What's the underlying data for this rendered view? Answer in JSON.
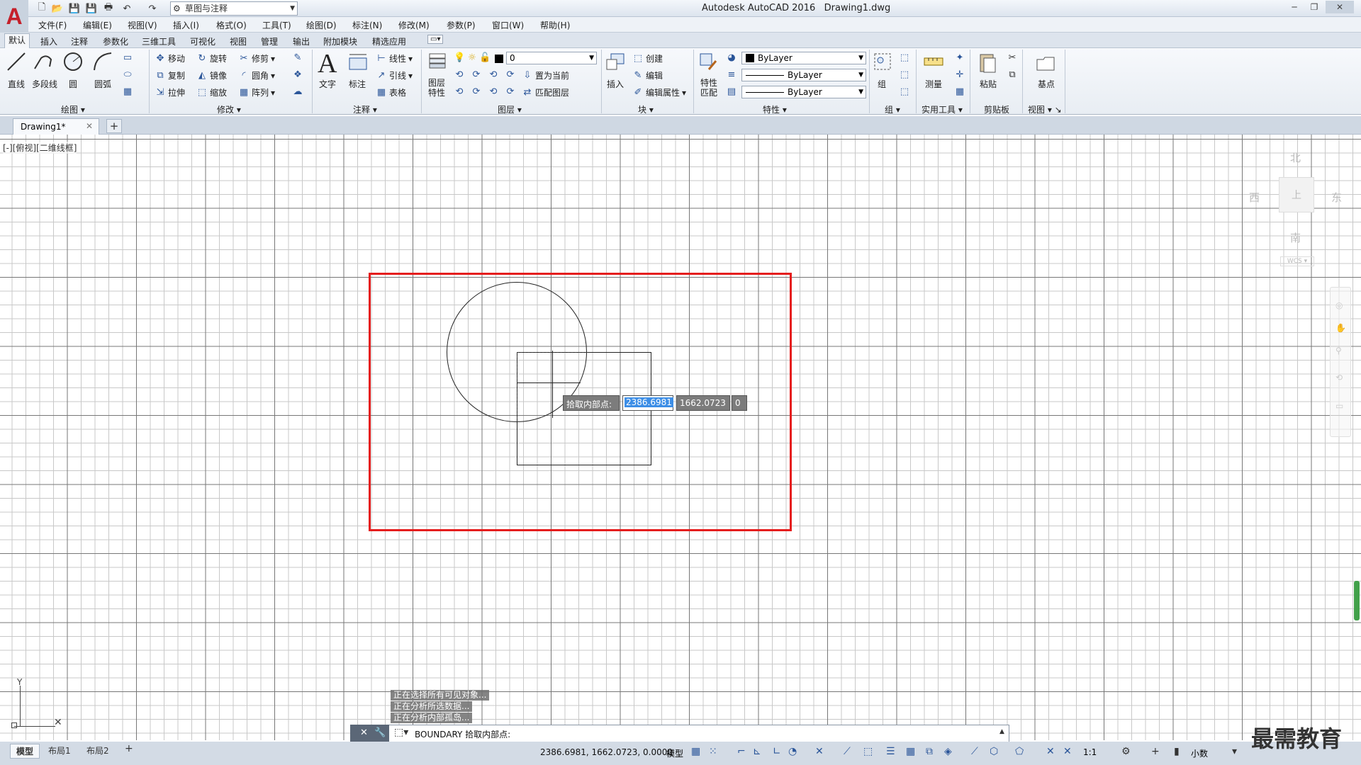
{
  "titlebar": {
    "app_title": "Autodesk AutoCAD 2016",
    "document": "Drawing1.dwg",
    "workspace": "草图与注释"
  },
  "menu": [
    "文件(F)",
    "编辑(E)",
    "视图(V)",
    "插入(I)",
    "格式(O)",
    "工具(T)",
    "绘图(D)",
    "标注(N)",
    "修改(M)",
    "参数(P)",
    "窗口(W)",
    "帮助(H)"
  ],
  "ribbon_tabs": [
    "默认",
    "插入",
    "注释",
    "参数化",
    "三维工具",
    "可视化",
    "视图",
    "管理",
    "输出",
    "附加模块",
    "精选应用"
  ],
  "ribbon": {
    "draw": {
      "title": "绘图",
      "line": "直线",
      "polyline": "多段线",
      "circle": "圆",
      "arc": "圆弧"
    },
    "modify": {
      "title": "修改",
      "move": "移动",
      "rotate": "旋转",
      "trim": "修剪",
      "copy": "复制",
      "mirror": "镜像",
      "fillet": "圆角",
      "stretch": "拉伸",
      "scale": "缩放",
      "array": "阵列"
    },
    "annotation": {
      "title": "注释",
      "text": "文字",
      "dimension": "标注",
      "linear": "线性",
      "leader": "引线",
      "table": "表格"
    },
    "layers": {
      "title": "图层",
      "properties_l1": "图层",
      "properties_l2": "特性",
      "current_layer": "0",
      "make_current": "置为当前",
      "match_layer": "匹配图层"
    },
    "block": {
      "title": "块",
      "insert": "插入",
      "create": "创建",
      "edit": "编辑",
      "edit_attributes": "编辑属性"
    },
    "properties": {
      "title": "特性",
      "match_l1": "特性",
      "match_l2": "匹配",
      "color": "ByLayer",
      "linetype": "ByLayer",
      "lineweight": "ByLayer"
    },
    "groups": {
      "title": "组",
      "group": "组"
    },
    "utilities": {
      "title": "实用工具",
      "measure": "测量"
    },
    "clipboard": {
      "title": "剪贴板",
      "paste": "粘贴"
    },
    "view": {
      "title": "视图",
      "base": "基点"
    }
  },
  "file_tab": {
    "name": "Drawing1*"
  },
  "viewport_label": "[-][俯视][二维线框]",
  "viewcube": {
    "north": "北",
    "south": "南",
    "east": "东",
    "west": "西",
    "top": "上",
    "wcs": "WCS"
  },
  "dynamic_input": {
    "prompt": "拾取内部点:",
    "x": "2386.6981",
    "y": "1662.0723",
    "z": "0"
  },
  "command_history": [
    "正在选择所有可见对象...",
    "正在分析所选数据...",
    "正在分析内部孤岛..."
  ],
  "command_line": "BOUNDARY 拾取内部点:",
  "layout_tabs": [
    "模型",
    "布局1",
    "布局2"
  ],
  "status": {
    "coords": "2386.6981, 1662.0723, 0.0000",
    "space": "模型",
    "scale": "1:1",
    "units": "小数"
  },
  "watermark": "最需教育",
  "colors": {
    "boundary_rect": "#e51d1d",
    "highlight": "#3d8ee6"
  }
}
